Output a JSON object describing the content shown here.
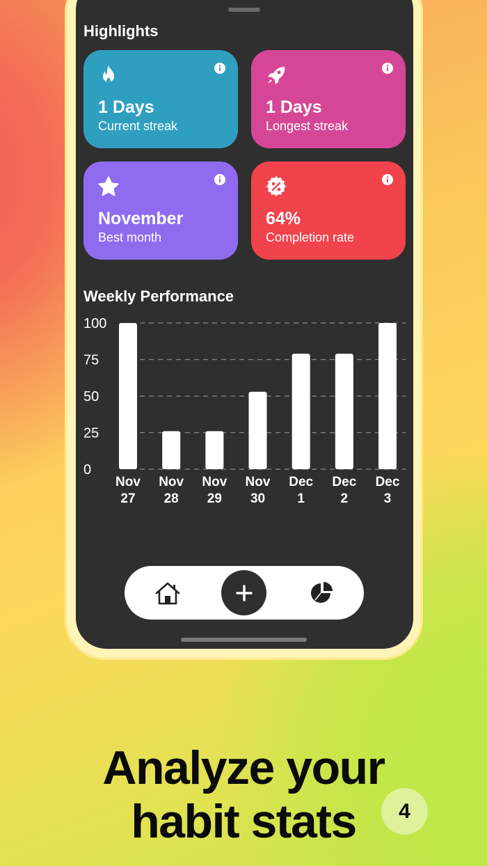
{
  "highlights": {
    "title": "Highlights",
    "cards": [
      {
        "value": "1 Days",
        "label": "Current streak",
        "icon": "flame-icon",
        "color": "#2f9fc0"
      },
      {
        "value": "1 Days",
        "label": "Longest streak",
        "icon": "rocket-icon",
        "color": "#d54796"
      },
      {
        "value": "November",
        "label": "Best month",
        "icon": "star-icon",
        "color": "#8f6bf0"
      },
      {
        "value": "64%",
        "label": "Completion rate",
        "icon": "percent-badge-icon",
        "color": "#f1434c"
      }
    ]
  },
  "weekly": {
    "title": "Weekly Performance"
  },
  "chart_data": {
    "type": "bar",
    "categories": [
      [
        "Nov",
        "27"
      ],
      [
        "Nov",
        "28"
      ],
      [
        "Nov",
        "29"
      ],
      [
        "Nov",
        "30"
      ],
      [
        "Dec",
        "1"
      ],
      [
        "Dec",
        "2"
      ],
      [
        "Dec",
        "3"
      ]
    ],
    "values": [
      100,
      26,
      26,
      53,
      79,
      79,
      100
    ],
    "yticks": [
      "100",
      "75",
      "50",
      "25",
      "0"
    ],
    "ylim": [
      0,
      100
    ],
    "grid": "dashed horizontal",
    "bar_color": "#ffffff"
  },
  "tabbar": {
    "items": [
      "home-icon",
      "add-icon",
      "stats-pie-icon"
    ]
  },
  "promo": {
    "line1": "Analyze your",
    "line2": "habit stats",
    "page_number": "4"
  }
}
